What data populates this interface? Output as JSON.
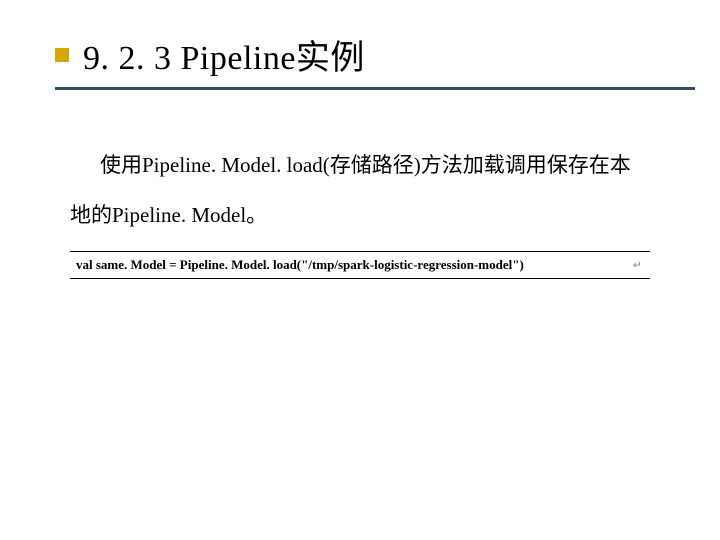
{
  "title": "9. 2. 3  Pipeline实例",
  "paragraph1": "使用Pipeline. Model. load(存储路径)方法加载调用保存在本",
  "paragraph2": "地的Pipeline. Model。",
  "code": "val same. Model = Pipeline. Model. load(\"/tmp/spark-logistic-regression-model\")",
  "return_symbol": "↵"
}
